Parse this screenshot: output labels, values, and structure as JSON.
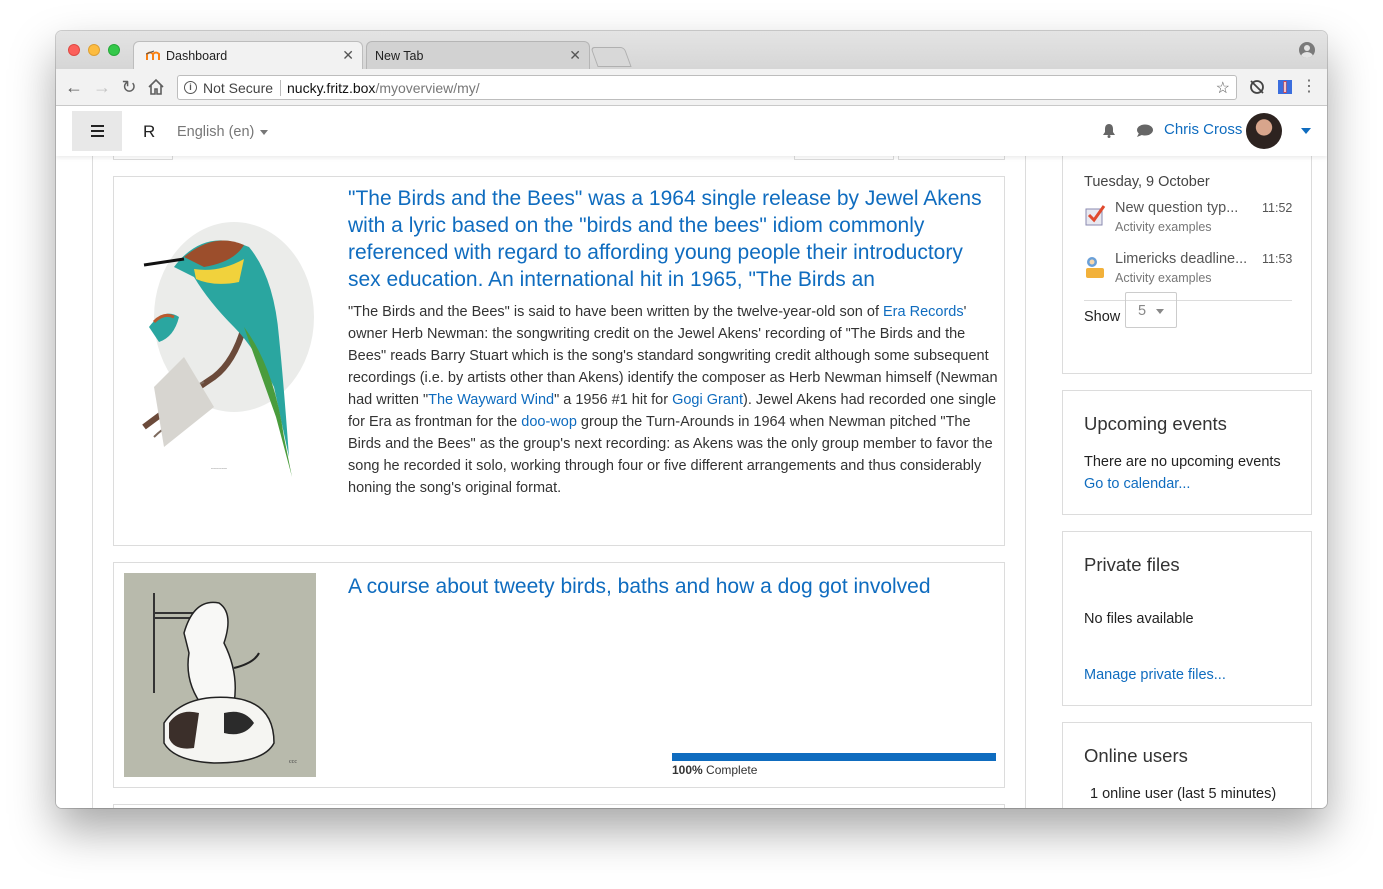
{
  "browser": {
    "tabs": [
      {
        "label": "Dashboard",
        "active": true
      },
      {
        "label": "New Tab",
        "active": false
      }
    ],
    "close_glyph": "✕",
    "address": {
      "security_label": "Not Secure",
      "host": "nucky.fritz.box",
      "path": "/myoverview/my/"
    }
  },
  "navbar": {
    "site_short": "R",
    "language": "English (en)",
    "user_name": "Chris Cross"
  },
  "courses": [
    {
      "title": "\"The Birds and the Bees\" was a 1964 single release by Jewel Akens with a lyric based on the \"birds and the bees\" idiom commonly referenced with regard to affording young people their introductory sex education. An international hit in 1965, \"The Birds an",
      "summary": {
        "t1": "\"The Birds and the Bees\" is said to have been written by the twelve-year-old son of ",
        "l1": "Era Records",
        "t2": "' owner Herb Newman: the songwriting credit on the Jewel Akens' recording of \"The Birds and the Bees\" reads Barry Stuart which is the song's standard songwriting credit although some subsequent recordings (i.e. by artists other than Akens) identify the composer as Herb Newman himself (Newman had written \"",
        "l2": "The Wayward Wind",
        "t3": "\" a 1956 #1 hit for ",
        "l3": "Gogi Grant",
        "t4": "). Jewel Akens had recorded one single for Era as frontman for the ",
        "l4": "doo-wop",
        "t5": " group the Turn-Arounds in 1964 when Newman pitched \"The Birds and the Bees\" as the group's next recording: as Akens was the only group member to favor the song he recorded it solo, working through four or five different arrangements and thus considerably honing the song's original format."
      }
    },
    {
      "title": "A course about tweety birds, baths and how a dog got involved",
      "progress_percent": 100,
      "progress_value": "100%",
      "progress_suffix": " Complete"
    }
  ],
  "timeline": {
    "date": "Tuesday, 9 October",
    "items": [
      {
        "name": "New question typ...",
        "course": "Activity examples",
        "time": "11:52",
        "icon": "quiz-icon"
      },
      {
        "name": "Limericks deadline...",
        "course": "Activity examples",
        "time": "11:53",
        "icon": "assignment-icon"
      }
    ],
    "show_label": "Show",
    "show_value": "5"
  },
  "upcoming": {
    "title": "Upcoming events",
    "empty_text": "There are no upcoming events",
    "link": "Go to calendar..."
  },
  "private_files": {
    "title": "Private files",
    "empty_text": "No files available",
    "link": "Manage private files..."
  },
  "online_users": {
    "title": "Online users",
    "summary": "1 online user (last 5 minutes)"
  },
  "colors": {
    "link_blue": "#0f6cbf",
    "progress_blue": "#0f6cbf"
  }
}
